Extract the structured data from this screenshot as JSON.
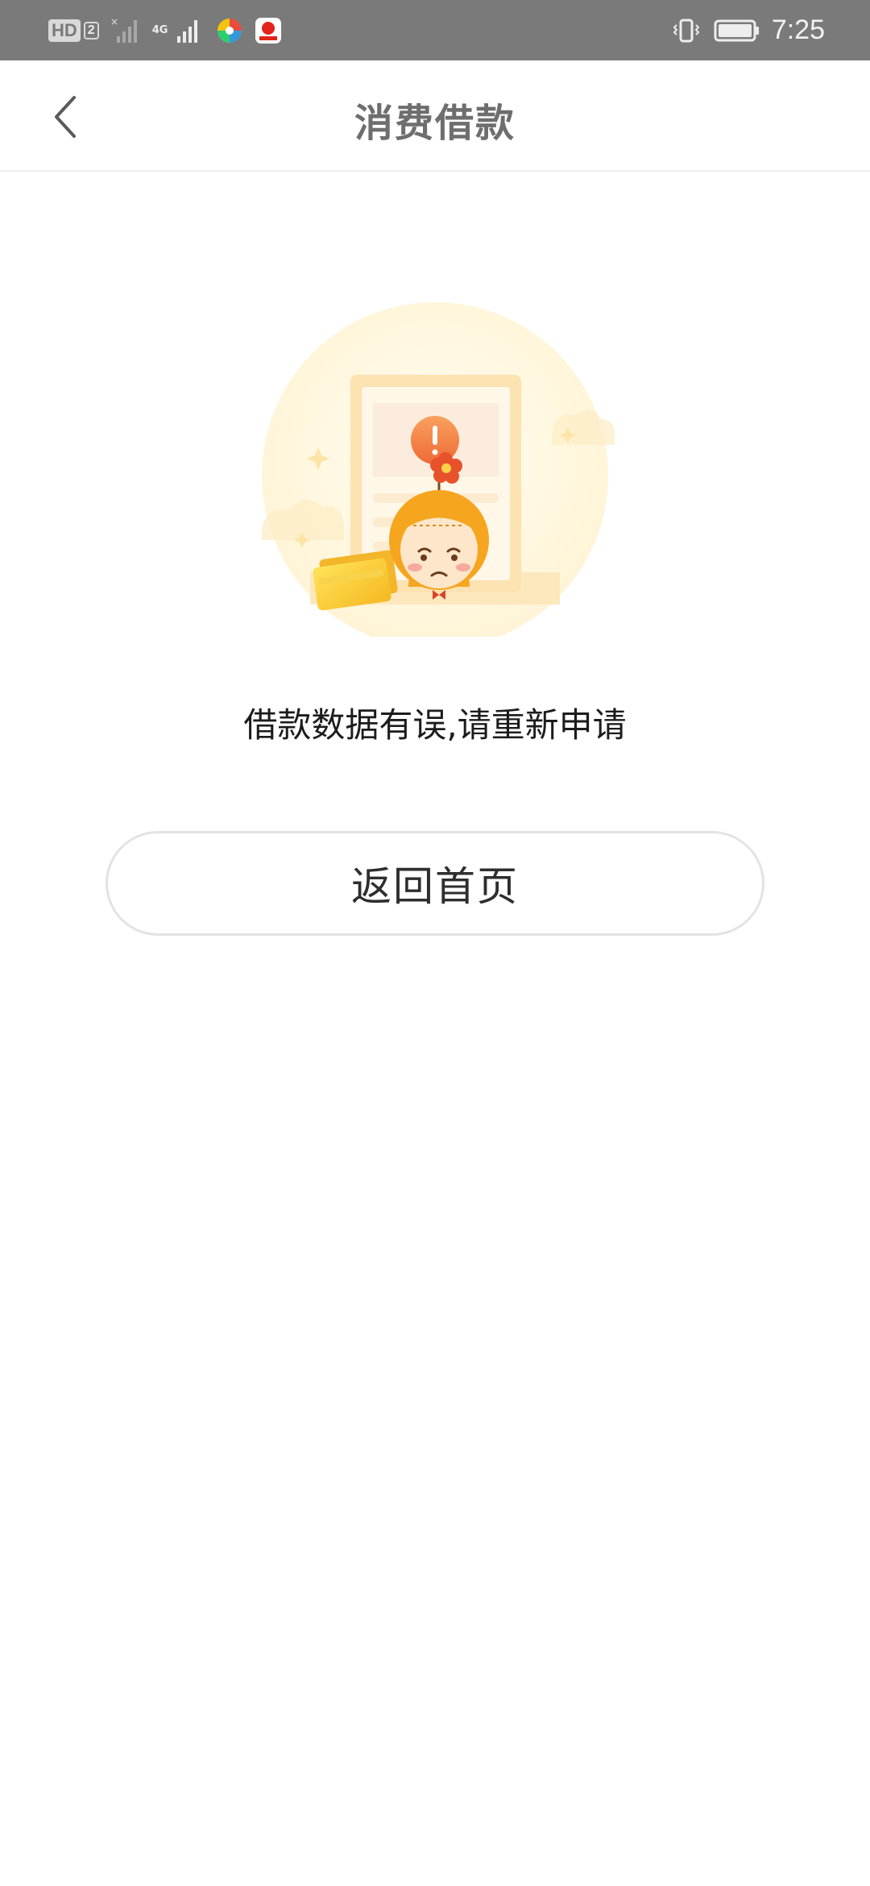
{
  "status_bar": {
    "hd_label": "HD",
    "sim_label": "2",
    "network_label": "4G",
    "time": "7:25",
    "icons": [
      "hd-icon",
      "signal-icon",
      "app-icon-colorful",
      "app-icon-sina",
      "vibrate-icon",
      "battery-icon"
    ]
  },
  "header": {
    "title": "消费借款",
    "back_icon": "chevron-left-icon"
  },
  "main": {
    "message": "借款数据有误,请重新申请",
    "home_button_label": "返回首页"
  },
  "colors": {
    "status_bar_bg": "#7a7a7a",
    "title_text": "#6e6e6e",
    "illustration_accent": "#f5a623",
    "alert_orange": "#f07a3c",
    "button_border": "#e3e3e3"
  }
}
